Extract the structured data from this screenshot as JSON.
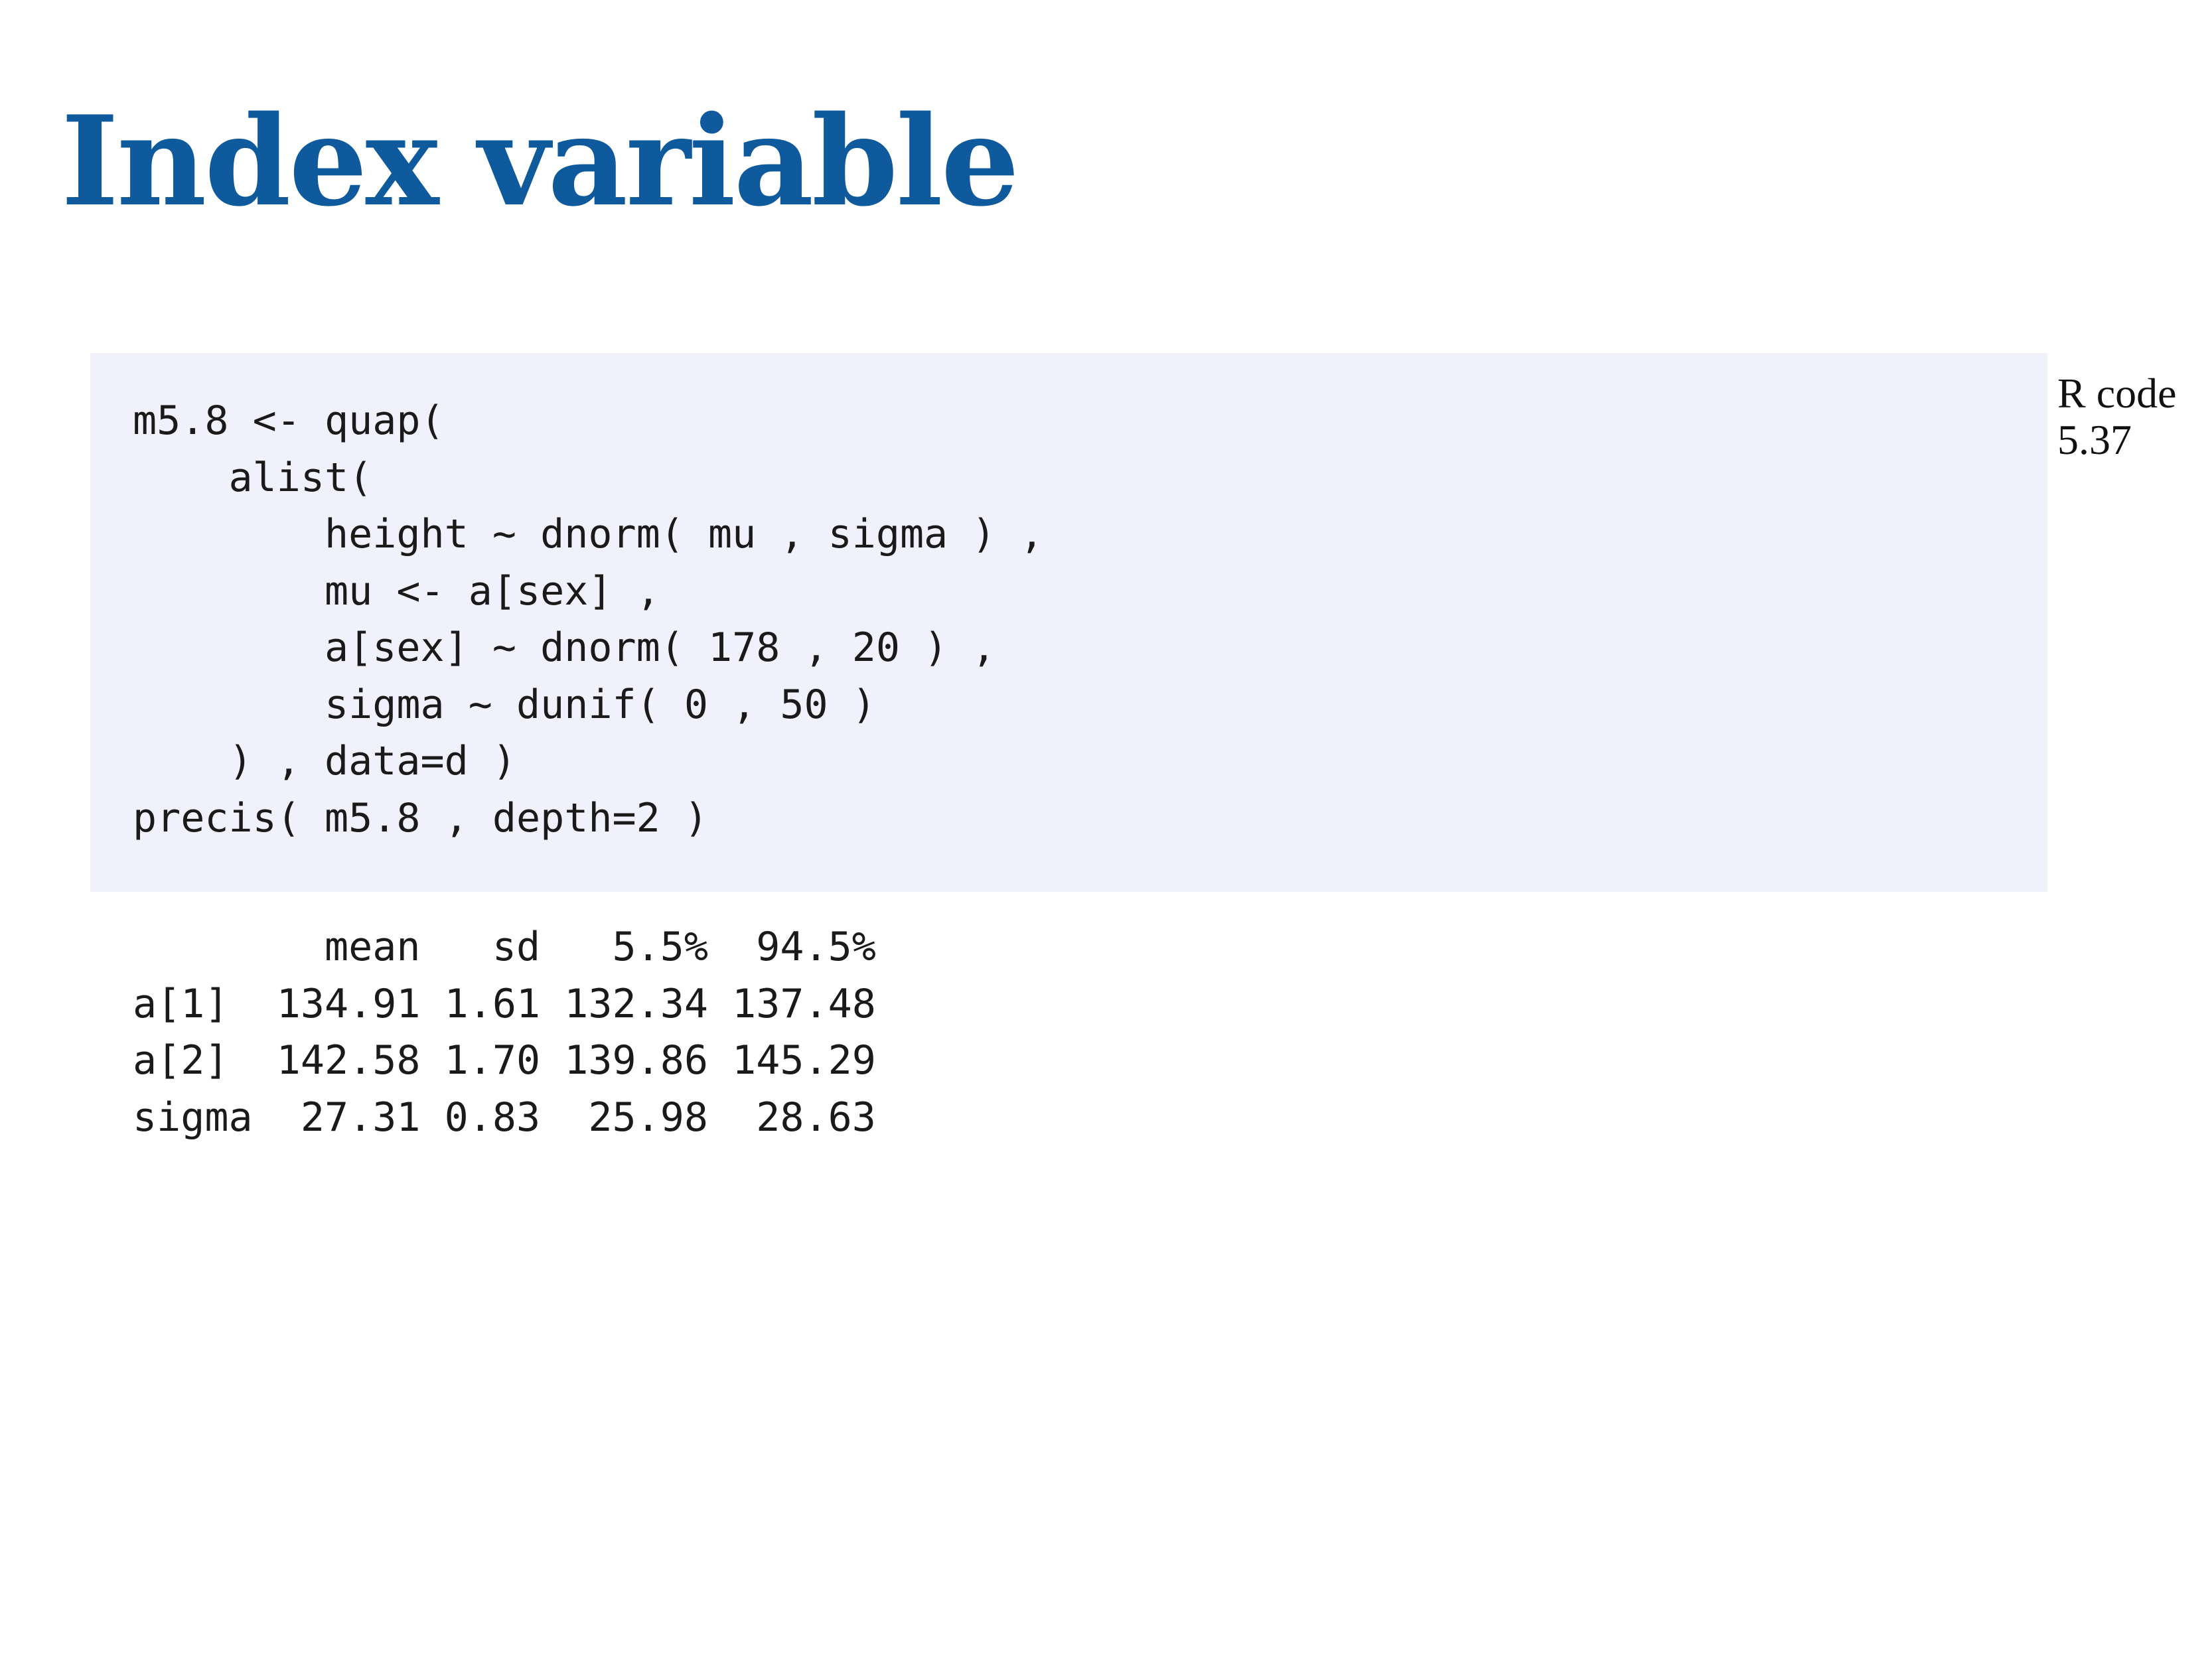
{
  "slide": {
    "title": "Index variable"
  },
  "code_block": {
    "language_label": "R code",
    "listing_number": "5.37",
    "lines": [
      "m5.8 <- quap(",
      "    alist(",
      "        height ~ dnorm( mu , sigma ) ,",
      "        mu <- a[sex] ,",
      "        a[sex] ~ dnorm( 178 , 20 ) ,",
      "        sigma ~ dunif( 0 , 50 )",
      "    ) , data=d )",
      "precis( m5.8 , depth=2 )"
    ]
  },
  "output": {
    "header": "        mean   sd   5.5%  94.5%",
    "rows": [
      "a[1]  134.91 1.61 132.34 137.48",
      "a[2]  142.58 1.70 139.86 145.29",
      "sigma  27.31 0.83  25.98  28.63"
    ]
  }
}
